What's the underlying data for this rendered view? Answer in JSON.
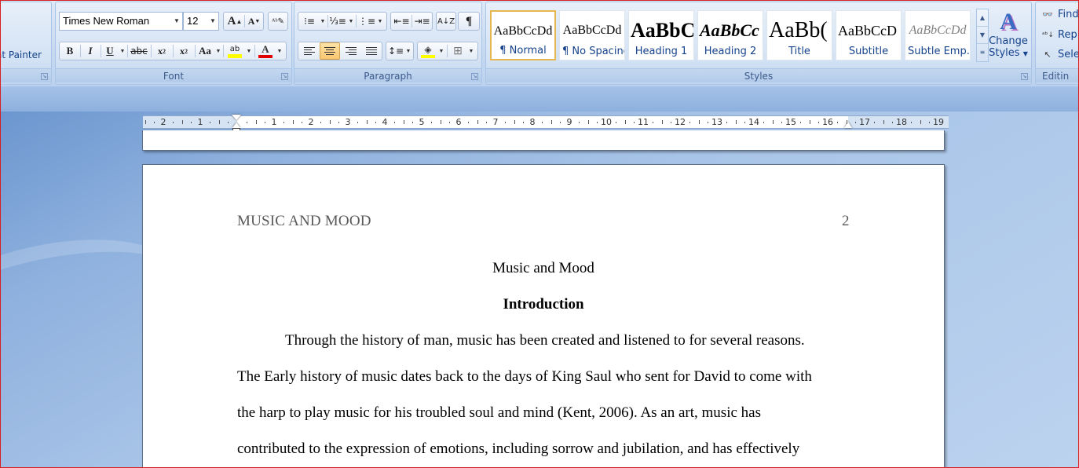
{
  "clipboard": {
    "format_painter_label": "at Painter"
  },
  "font": {
    "group_label": "Font",
    "font_name": "Times New Roman",
    "font_size": "12"
  },
  "paragraph": {
    "group_label": "Paragraph"
  },
  "styles": {
    "group_label": "Styles",
    "items": [
      {
        "preview": "AaBbCcDd",
        "name": "¶ Normal"
      },
      {
        "preview": "AaBbCcDd",
        "name": "¶ No Spacing"
      },
      {
        "preview": "AaBbC(",
        "name": "Heading 1"
      },
      {
        "preview": "AaBbCc",
        "name": "Heading 2"
      },
      {
        "preview": "AaBb(",
        "name": "Title"
      },
      {
        "preview": "AaBbCcD",
        "name": "Subtitle"
      },
      {
        "preview": "AaBbCcDd",
        "name": "Subtle Emp..."
      }
    ],
    "change_styles_line1": "Change",
    "change_styles_line2": "Styles"
  },
  "editing": {
    "group_label": "Editin",
    "find": "Find",
    "replace": "Repl",
    "select": "Sele"
  },
  "ruler": {
    "left_numbers": [
      "2",
      "1"
    ],
    "right_numbers": [
      "1",
      "2",
      "3",
      "4",
      "5",
      "6",
      "7",
      "8",
      "9",
      "10",
      "11",
      "12",
      "13",
      "14",
      "15",
      "16",
      "17",
      "18",
      "19"
    ]
  },
  "document": {
    "running_head": "MUSIC AND MOOD",
    "page_number": "2",
    "title": "Music and Mood",
    "heading": "Introduction",
    "lines": [
      "Through the history of man, music has been created and listened to for several reasons.",
      "The Early history of music dates back to the days of King Saul who sent for David to come with",
      "the harp to play music for his troubled soul and mind (Kent, 2006). As an art, music has",
      "contributed to the expression of emotions, including sorrow and jubilation, and has effectively"
    ]
  },
  "colors": {
    "highlight": "#ffff00",
    "font_color": "#e00000",
    "selected_style_border": "#e6b74e"
  }
}
